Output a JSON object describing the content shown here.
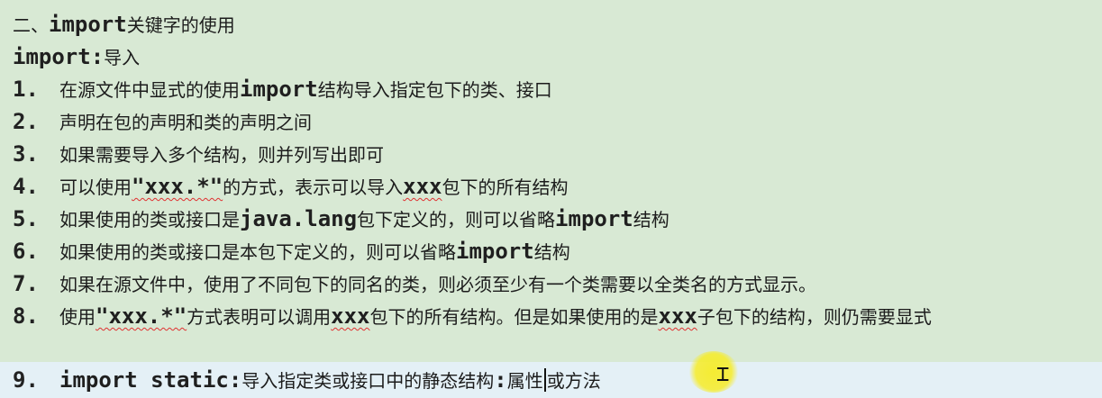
{
  "lines": {
    "heading": {
      "prefix": "二、",
      "keyword": "import",
      "suffix": "关键字的使用"
    },
    "def": {
      "keyword": "import",
      "colon": ":",
      "text": "导入"
    },
    "l1": {
      "num": "1.",
      "a": "在源文件中显式的使用",
      "b": "import",
      "c": "结构导入指定包下的类、接口"
    },
    "l2": {
      "num": "2.",
      "a": "声明在包的声明和类的声明之间"
    },
    "l3": {
      "num": "3.",
      "a": "如果需要导入多个结构，则并列写出即可"
    },
    "l4": {
      "num": "4.",
      "a": "可以使用",
      "b": "\"xxx.*\"",
      "c": "的方式，表示可以导入",
      "d": "xxx",
      "e": "包下的所有结构"
    },
    "l5": {
      "num": "5.",
      "a": "如果使用的类或接口是",
      "b": "java.lang",
      "c": "包下定义的，则可以省略",
      "d": "import",
      "e": "结构"
    },
    "l6": {
      "num": "6.",
      "a": "如果使用的类或接口是本包下定义的，则可以省略",
      "b": "import",
      "c": "结构"
    },
    "l7": {
      "num": "7.",
      "a": "如果在源文件中，使用了不同包下的同名的类，则必须至少有一个类需要以全类名的方式显示。"
    },
    "l8": {
      "num": "8.",
      "a": "使用",
      "b": "\"xxx.*\"",
      "c": "方式表明可以调用",
      "d": "xxx",
      "e": "包下的所有结构。但是如果使用的是",
      "f": "xxx",
      "g": "子包下的结构，则仍需要显式"
    },
    "l9": {
      "num": "9.",
      "a": "import static",
      "b": ":",
      "c": "导入指定类或接口中的静态结构",
      "d": ":",
      "e": "属性",
      "f": "或方法"
    }
  }
}
